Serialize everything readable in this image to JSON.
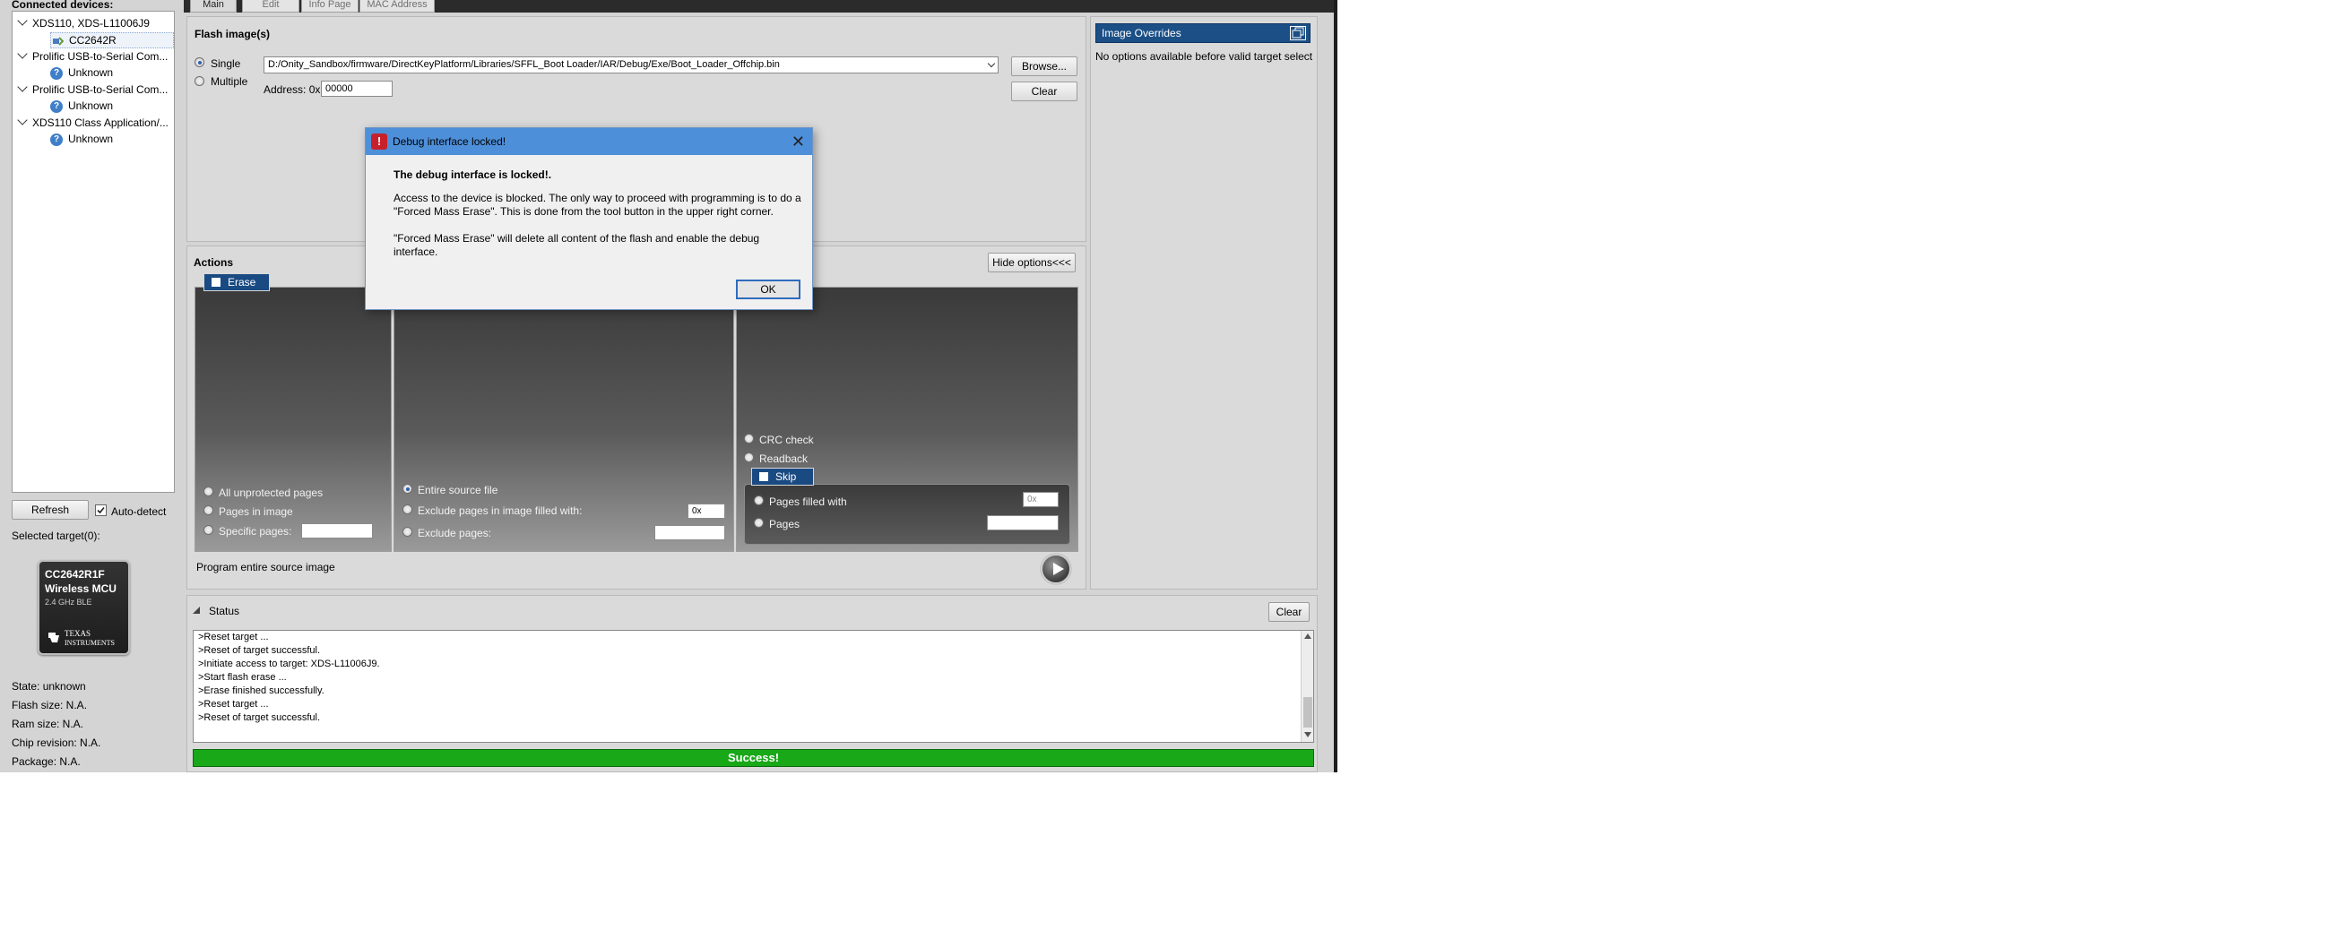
{
  "left": {
    "connected_label": "Connected devices:",
    "tree": [
      {
        "label": "XDS110, XDS-L11006J9",
        "child": "CC2642R",
        "child_icon": "chip-icon"
      },
      {
        "label": "Prolific USB-to-Serial Com...",
        "child": "Unknown",
        "child_icon": "question-icon"
      },
      {
        "label": "Prolific USB-to-Serial Com...",
        "child": "Unknown",
        "child_icon": "question-icon"
      },
      {
        "label": "XDS110 Class Application/...",
        "child": "Unknown",
        "child_icon": "question-icon"
      }
    ],
    "refresh_label": "Refresh",
    "auto_detect_label": "Auto-detect",
    "auto_detect_checked": true,
    "selected_targets": "Selected target(0):",
    "chip": {
      "name": "CC2642R1F",
      "subtitle": "Wireless MCU",
      "band": "2.4 GHz BLE",
      "vendor_line1": "Texas",
      "vendor_line2": "Instruments"
    },
    "info": [
      "State: unknown",
      "Flash size: N.A.",
      "Ram size: N.A.",
      "Chip revision: N.A.",
      "Package: N.A."
    ]
  },
  "tabs": [
    "Main",
    "Edit",
    "Info Page",
    "MAC Address"
  ],
  "flash": {
    "header": "Flash image(s)",
    "single_label": "Single",
    "multiple_label": "Multiple",
    "path": "D:/Onity_Sandbox/firmware/DirectKeyPlatform/Libraries/SFFL_Boot Loader/IAR/Debug/Exe/Boot_Loader_Offchip.bin",
    "address_label": "Address: 0x",
    "address_value": "00000",
    "browse_label": "Browse...",
    "clear_label": "Clear"
  },
  "overrides": {
    "title": "Image Overrides",
    "message": "No options available before valid target select"
  },
  "actions": {
    "header": "Actions",
    "hide_options_label": "Hide options<<<",
    "erase_label": "Erase",
    "erase_options": [
      "All unprotected pages",
      "Pages in image",
      "Specific pages:"
    ],
    "program_options": [
      "Entire source file",
      "Exclude pages in image filled with:",
      "Exclude pages:"
    ],
    "program_fill_value": "0x",
    "verify_options": [
      "CRC check",
      "Readback"
    ],
    "skip_label": "Skip",
    "skip_options": [
      "Pages filled with",
      "Pages"
    ],
    "skip_fill_value": "0x",
    "summary": "Program entire source image"
  },
  "status": {
    "header": "Status",
    "clear_label": "Clear",
    "log": [
      ">Reset target ...",
      ">Reset of target successful.",
      ">Initiate access to target: XDS-L11006J9.",
      ">Start flash erase ...",
      ">Erase finished successfully.",
      ">Reset target ...",
      ">Reset of target successful."
    ],
    "result": "Success!",
    "result_color": "#18a818"
  },
  "dialog": {
    "title": "Debug interface locked!",
    "heading": "The debug interface is locked!.",
    "line1": "Access to the device is blocked. The only way to proceed with programming is to do a",
    "line2": "\"Forced Mass Erase\". This is done from the tool button in the upper right corner.",
    "line3": "\"Forced Mass Erase\" will delete all content of the flash and enable the debug interface.",
    "ok_label": "OK"
  }
}
